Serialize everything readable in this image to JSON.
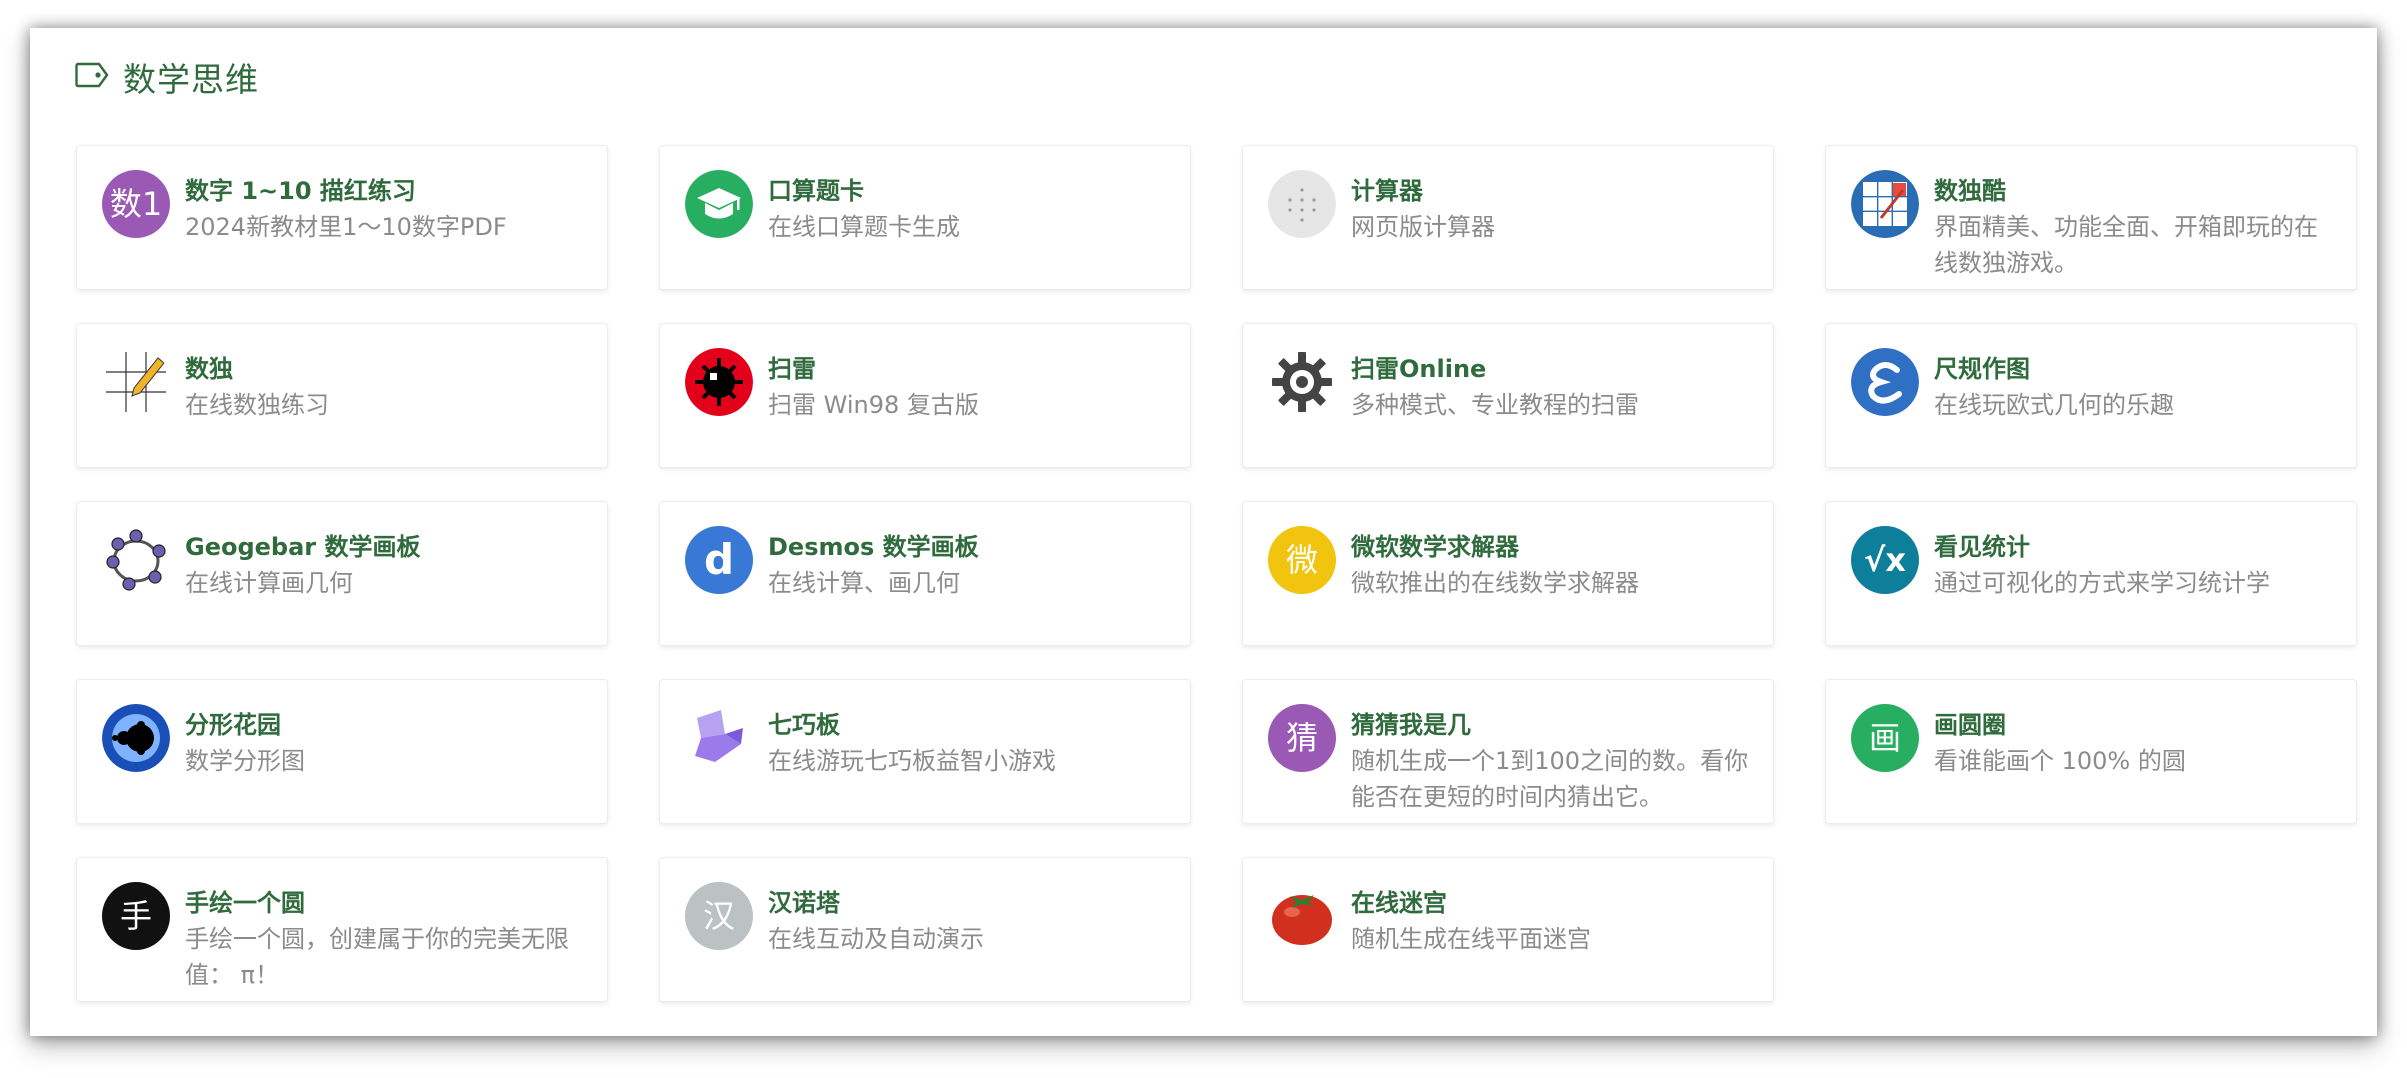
{
  "section": {
    "title": "数学思维",
    "icon": "tag-icon"
  },
  "cards": [
    {
      "title": "数字 1~10 描红练习",
      "desc": "2024新教材里1～10数字PDF",
      "icon": "purple-num-icon",
      "glyph": "数1",
      "color": "#9b59b6"
    },
    {
      "title": "口算题卡",
      "desc": "在线口算题卡生成",
      "icon": "graduation-cap-icon",
      "color": "#27ae60"
    },
    {
      "title": "计算器",
      "desc": "网页版计算器",
      "icon": "calculator-icon",
      "color": "#e6e6e6"
    },
    {
      "title": "数独酷",
      "desc": "界面精美、功能全面、开箱即玩的在线数独游戏。",
      "icon": "sudoku-grid-icon",
      "color": "#2a6db5"
    },
    {
      "title": "数独",
      "desc": "在线数独练习",
      "icon": "sudoku-pencil-icon",
      "color": "#f0b429"
    },
    {
      "title": "扫雷",
      "desc": "扫雷 Win98 复古版",
      "icon": "mine-icon",
      "color": "#e3001b"
    },
    {
      "title": "扫雷Online",
      "desc": "多种模式、专业教程的扫雷",
      "icon": "gear-mine-icon",
      "color": "#444444"
    },
    {
      "title": "尺规作图",
      "desc": "在线玩欧式几何的乐趣",
      "icon": "compass-logo-icon",
      "color": "#2f6fc4"
    },
    {
      "title": "Geogebar 数学画板",
      "desc": "在线计算画几何",
      "icon": "geogebra-icon",
      "color": "#6c5fb0"
    },
    {
      "title": "Desmos 数学画板",
      "desc": "在线计算、画几何",
      "icon": "desmos-icon",
      "glyph": "d",
      "color": "#3a78d6"
    },
    {
      "title": "微软数学求解器",
      "desc": "微软推出的在线数学求解器",
      "icon": "microsoft-math-icon",
      "glyph": "微",
      "color": "#f1c40f"
    },
    {
      "title": "看见统计",
      "desc": "通过可视化的方式来学习统计学",
      "icon": "sqrt-x-icon",
      "glyph": "√x",
      "color": "#0e7f9a"
    },
    {
      "title": "分形花园",
      "desc": "数学分形图",
      "icon": "fractal-icon",
      "color": "#1b4fb8"
    },
    {
      "title": "七巧板",
      "desc": "在线游玩七巧板益智小游戏",
      "icon": "tangram-icon",
      "color": "#9b7bea"
    },
    {
      "title": "猜猜我是几",
      "desc": "随机生成一个1到100之间的数。看你能否在更短的时间内猜出它。",
      "icon": "guess-icon",
      "glyph": "猜",
      "color": "#9b59b6"
    },
    {
      "title": "画圆圈",
      "desc": "看谁能画个 100% 的圆",
      "icon": "draw-circle-icon",
      "glyph": "画",
      "color": "#27ae60"
    },
    {
      "title": "手绘一个圆",
      "desc": "手绘一个圆，创建属于你的完美无限值： π！",
      "icon": "hand-draw-icon",
      "glyph": "手",
      "color": "#111111"
    },
    {
      "title": "汉诺塔",
      "desc": "在线互动及自动演示",
      "icon": "hanoi-icon",
      "glyph": "汉",
      "color": "#bcc1c4"
    },
    {
      "title": "在线迷宫",
      "desc": "随机生成在线平面迷宫",
      "icon": "tomato-icon",
      "color": "#d2301f"
    }
  ]
}
